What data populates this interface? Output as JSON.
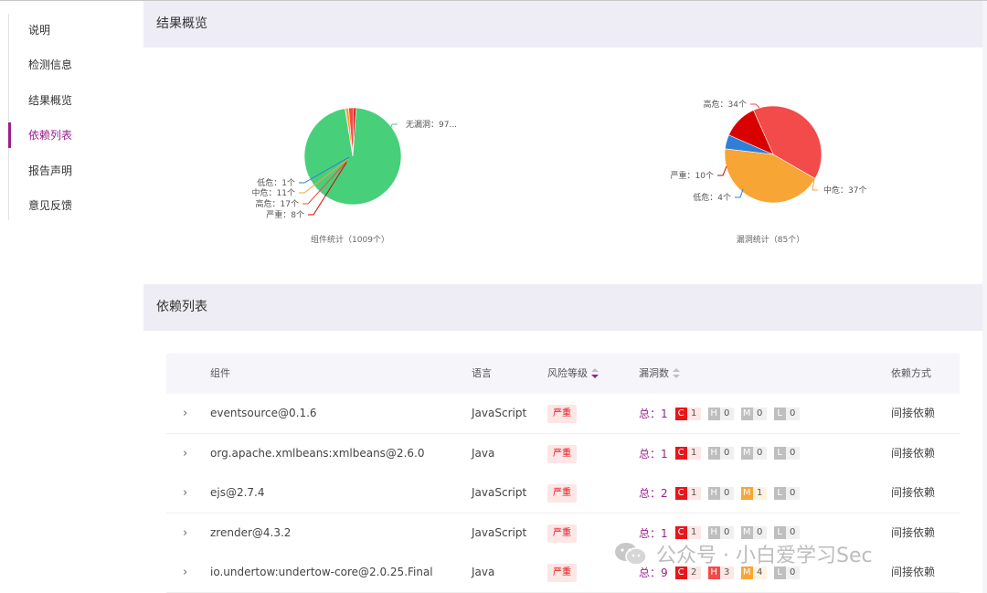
{
  "sidebar": {
    "items": [
      {
        "label": "说明"
      },
      {
        "label": "检测信息"
      },
      {
        "label": "结果概览"
      },
      {
        "label": "依赖列表"
      },
      {
        "label": "报告声明"
      },
      {
        "label": "意见反馈"
      }
    ],
    "active_index": 3
  },
  "overview": {
    "title": "结果概览"
  },
  "chart_data": [
    {
      "type": "pie",
      "title": "组件统计（1009个）",
      "slices": [
        {
          "label": "无漏洞：97...",
          "value": 972,
          "color": "#48cf7a"
        },
        {
          "label": "低危：1个",
          "value": 1,
          "color": "#2f7ed8"
        },
        {
          "label": "中危：11个",
          "value": 11,
          "color": "#f7a535"
        },
        {
          "label": "高危：17个",
          "value": 17,
          "color": "#f34a4a"
        },
        {
          "label": "严重：8个",
          "value": 8,
          "color": "#d90000"
        }
      ]
    },
    {
      "type": "pie",
      "title": "漏洞统计（85个）",
      "slices": [
        {
          "label": "高危：34个",
          "value": 34,
          "color": "#f34a4a"
        },
        {
          "label": "中危：37个",
          "value": 37,
          "color": "#f7a535"
        },
        {
          "label": "低危：4个",
          "value": 4,
          "color": "#2f7ed8"
        },
        {
          "label": "严重：10个",
          "value": 10,
          "color": "#d90000"
        }
      ]
    }
  ],
  "deps": {
    "title": "依赖列表",
    "headers": {
      "component": "组件",
      "language": "语言",
      "risk": "风险等级",
      "vulns": "漏洞数",
      "dep_type": "依赖方式"
    },
    "rows": [
      {
        "name": "eventsource@0.1.6",
        "language": "JavaScript",
        "risk": "严重",
        "total": "总：1",
        "c": "1",
        "h": "0",
        "m": "0",
        "l": "0",
        "dep": "间接依赖"
      },
      {
        "name": "org.apache.xmlbeans:xmlbeans@2.6.0",
        "language": "Java",
        "risk": "严重",
        "total": "总：1",
        "c": "1",
        "h": "0",
        "m": "0",
        "l": "0",
        "dep": "间接依赖"
      },
      {
        "name": "ejs@2.7.4",
        "language": "JavaScript",
        "risk": "严重",
        "total": "总：2",
        "c": "1",
        "h": "0",
        "m": "1",
        "l": "0",
        "dep": "间接依赖"
      },
      {
        "name": "zrender@4.3.2",
        "language": "JavaScript",
        "risk": "严重",
        "total": "总：1",
        "c": "1",
        "h": "0",
        "m": "0",
        "l": "0",
        "dep": "间接依赖"
      },
      {
        "name": "io.undertow:undertow-core@2.0.25.Final",
        "language": "Java",
        "risk": "严重",
        "total": "总：9",
        "c": "2",
        "h": "3",
        "m": "4",
        "l": "0",
        "dep": "间接依赖"
      }
    ]
  },
  "severity_letters": {
    "c": "C",
    "h": "H",
    "m": "M",
    "l": "L"
  },
  "colors": {
    "accent": "#9b1f8c",
    "critical": "#e8161b",
    "high": "#f34a4a",
    "medium": "#f7a535",
    "zero": "#bfbfbf"
  },
  "watermark": {
    "text": "公众号 · 小白爱学习Sec"
  }
}
